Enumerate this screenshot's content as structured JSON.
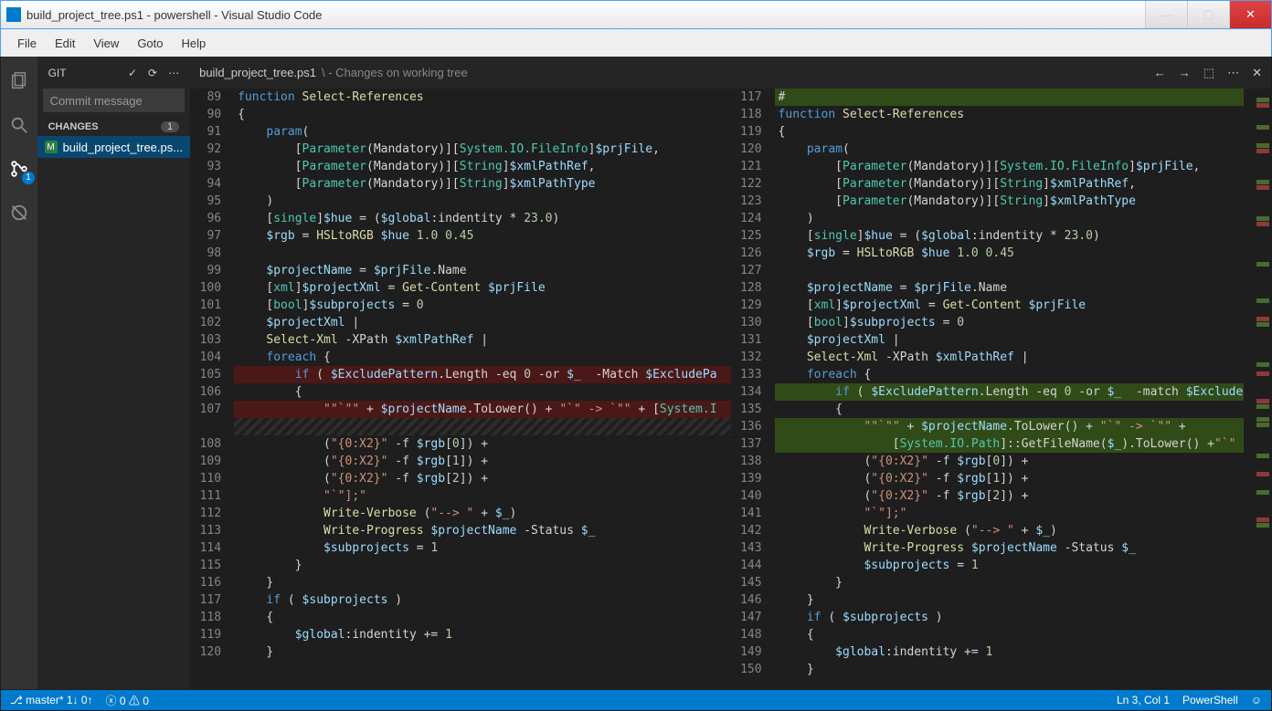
{
  "window": {
    "title": "build_project_tree.ps1 - powershell - Visual Studio Code"
  },
  "menu": {
    "file": "File",
    "edit": "Edit",
    "view": "View",
    "goto": "Goto",
    "help": "Help"
  },
  "activitybar": {
    "scm_badge": "1"
  },
  "sidebar": {
    "title": "GIT",
    "commit_placeholder": "Commit message",
    "section_label": "CHANGES",
    "changes_count": "1",
    "file_label": "build_project_tree.ps...",
    "file_status": "M"
  },
  "tab": {
    "name": "build_project_tree.ps1",
    "suffix": "\\ - Changes on working tree"
  },
  "left_lines": [
    {
      "n": "89",
      "cls": "",
      "html": "<span class='k-blue'>function</span> <span class='k-yellow'>Select-References</span>"
    },
    {
      "n": "90",
      "cls": "",
      "html": "<span class='k-plain'>{</span>"
    },
    {
      "n": "91",
      "cls": "",
      "html": "    <span class='k-blue'>param</span><span class='k-plain'>(</span>"
    },
    {
      "n": "92",
      "cls": "",
      "html": "        <span class='k-plain'>[</span><span class='k-teal'>Parameter</span><span class='k-plain'>(Mandatory)][</span><span class='k-teal'>System.IO.FileInfo</span><span class='k-plain'>]</span><span class='k-var'>$prjFile</span><span class='k-plain'>,</span>"
    },
    {
      "n": "93",
      "cls": "",
      "html": "        <span class='k-plain'>[</span><span class='k-teal'>Parameter</span><span class='k-plain'>(Mandatory)][</span><span class='k-teal'>String</span><span class='k-plain'>]</span><span class='k-var'>$xmlPathRef</span><span class='k-plain'>,</span>"
    },
    {
      "n": "94",
      "cls": "",
      "html": "        <span class='k-plain'>[</span><span class='k-teal'>Parameter</span><span class='k-plain'>(Mandatory)][</span><span class='k-teal'>String</span><span class='k-plain'>]</span><span class='k-var'>$xmlPathType</span>"
    },
    {
      "n": "95",
      "cls": "",
      "html": "    <span class='k-plain'>)</span>"
    },
    {
      "n": "96",
      "cls": "",
      "html": "    <span class='k-plain'>[</span><span class='k-teal'>single</span><span class='k-plain'>]</span><span class='k-var'>$hue</span> <span class='k-plain'>= (</span><span class='k-var'>$global</span><span class='k-plain'>:indentity * </span><span class='k-num'>23.0</span><span class='k-plain'>)</span>"
    },
    {
      "n": "97",
      "cls": "",
      "html": "    <span class='k-var'>$rgb</span> <span class='k-plain'>= </span><span class='k-yellow'>HSLtoRGB</span> <span class='k-var'>$hue</span> <span class='k-num'>1.0 0.45</span>"
    },
    {
      "n": "98",
      "cls": "",
      "html": ""
    },
    {
      "n": "99",
      "cls": "",
      "html": "    <span class='k-var'>$projectName</span> <span class='k-plain'>= </span><span class='k-var'>$prjFile</span><span class='k-plain'>.Name</span>"
    },
    {
      "n": "100",
      "cls": "",
      "html": "    <span class='k-plain'>[</span><span class='k-teal'>xml</span><span class='k-plain'>]</span><span class='k-var'>$projectXml</span> <span class='k-plain'>= </span><span class='k-yellow'>Get-Content</span> <span class='k-var'>$prjFile</span>"
    },
    {
      "n": "101",
      "cls": "",
      "html": "    <span class='k-plain'>[</span><span class='k-teal'>bool</span><span class='k-plain'>]</span><span class='k-var'>$subprojects</span> <span class='k-plain'>= </span><span class='k-num'>0</span>"
    },
    {
      "n": "102",
      "cls": "",
      "html": "    <span class='k-var'>$projectXml</span> <span class='k-plain'>|</span>"
    },
    {
      "n": "103",
      "cls": "",
      "html": "    <span class='k-yellow'>Select-Xml</span> <span class='k-plain'>-XPath </span><span class='k-var'>$xmlPathRef</span> <span class='k-plain'>|</span>"
    },
    {
      "n": "104",
      "cls": "",
      "html": "    <span class='k-blue'>foreach</span> <span class='k-plain'>{</span>"
    },
    {
      "n": "105",
      "cls": "del",
      "html": "        <span class='k-blue'>if</span> <span class='k-plain'>( </span><span class='k-var'>$ExcludePattern</span><span class='k-plain'>.Length -eq </span><span class='k-num'>0</span> <span class='k-plain'>-or </span><span class='k-var'>$_</span> <span class='k-plain'> -Match </span><span class='k-var'>$ExcludePa</span>"
    },
    {
      "n": "106",
      "cls": "",
      "html": "        <span class='k-plain'>{</span>"
    },
    {
      "n": "107",
      "cls": "del",
      "html": "            <span class='k-str'>\"\"`\"\"</span> <span class='k-plain'>+ </span><span class='k-var'>$projectName</span><span class='k-plain'>.ToLower() + </span><span class='k-str'>\"`\" -> `\"\"</span> <span class='k-plain'>+ [</span><span class='k-teal'>System.I</span>"
    },
    {
      "n": "",
      "cls": "hatch",
      "html": ""
    },
    {
      "n": "108",
      "cls": "",
      "html": "            <span class='k-plain'>(</span><span class='k-str'>\"{0:X2}\"</span> <span class='k-plain'>-f </span><span class='k-var'>$rgb</span><span class='k-plain'>[</span><span class='k-num'>0</span><span class='k-plain'>]) +</span>"
    },
    {
      "n": "109",
      "cls": "",
      "html": "            <span class='k-plain'>(</span><span class='k-str'>\"{0:X2}\"</span> <span class='k-plain'>-f </span><span class='k-var'>$rgb</span><span class='k-plain'>[</span><span class='k-num'>1</span><span class='k-plain'>]) +</span>"
    },
    {
      "n": "110",
      "cls": "",
      "html": "            <span class='k-plain'>(</span><span class='k-str'>\"{0:X2}\"</span> <span class='k-plain'>-f </span><span class='k-var'>$rgb</span><span class='k-plain'>[</span><span class='k-num'>2</span><span class='k-plain'>]) +</span>"
    },
    {
      "n": "111",
      "cls": "",
      "html": "            <span class='k-str'>\"`\"];\"</span>"
    },
    {
      "n": "112",
      "cls": "",
      "html": "            <span class='k-yellow'>Write-Verbose</span> <span class='k-plain'>(</span><span class='k-str'>\"--> \"</span> <span class='k-plain'>+ </span><span class='k-var'>$_</span><span class='k-plain'>)</span>"
    },
    {
      "n": "113",
      "cls": "",
      "html": "            <span class='k-yellow'>Write-Progress</span> <span class='k-var'>$projectName</span> <span class='k-plain'>-Status </span><span class='k-var'>$_</span>"
    },
    {
      "n": "114",
      "cls": "",
      "html": "            <span class='k-var'>$subprojects</span> <span class='k-plain'>= </span><span class='k-num'>1</span>"
    },
    {
      "n": "115",
      "cls": "",
      "html": "        <span class='k-plain'>}</span>"
    },
    {
      "n": "116",
      "cls": "",
      "html": "    <span class='k-plain'>}</span>"
    },
    {
      "n": "117",
      "cls": "",
      "html": "    <span class='k-blue'>if</span> <span class='k-plain'>( </span><span class='k-var'>$subprojects</span> <span class='k-plain'>)</span>"
    },
    {
      "n": "118",
      "cls": "",
      "html": "    <span class='k-plain'>{</span>"
    },
    {
      "n": "119",
      "cls": "",
      "html": "        <span class='k-var'>$global</span><span class='k-plain'>:indentity += </span><span class='k-num'>1</span>"
    },
    {
      "n": "120",
      "cls": "",
      "html": "    <span class='k-plain'>}</span>"
    }
  ],
  "right_lines": [
    {
      "n": "117",
      "cls": "add",
      "html": "<span class='k-plain'>#</span>"
    },
    {
      "n": "118",
      "cls": "",
      "html": "<span class='k-blue'>function</span> <span class='k-yellow'>Select-References</span>"
    },
    {
      "n": "119",
      "cls": "",
      "html": "<span class='k-plain'>{</span>"
    },
    {
      "n": "120",
      "cls": "",
      "html": "    <span class='k-blue'>param</span><span class='k-plain'>(</span>"
    },
    {
      "n": "121",
      "cls": "",
      "html": "        <span class='k-plain'>[</span><span class='k-teal'>Parameter</span><span class='k-plain'>(Mandatory)][</span><span class='k-teal'>System.IO.FileInfo</span><span class='k-plain'>]</span><span class='k-var'>$prjFile</span><span class='k-plain'>,</span>"
    },
    {
      "n": "122",
      "cls": "",
      "html": "        <span class='k-plain'>[</span><span class='k-teal'>Parameter</span><span class='k-plain'>(Mandatory)][</span><span class='k-teal'>String</span><span class='k-plain'>]</span><span class='k-var'>$xmlPathRef</span><span class='k-plain'>,</span>"
    },
    {
      "n": "123",
      "cls": "",
      "html": "        <span class='k-plain'>[</span><span class='k-teal'>Parameter</span><span class='k-plain'>(Mandatory)][</span><span class='k-teal'>String</span><span class='k-plain'>]</span><span class='k-var'>$xmlPathType</span>"
    },
    {
      "n": "124",
      "cls": "",
      "html": "    <span class='k-plain'>)</span>"
    },
    {
      "n": "125",
      "cls": "",
      "html": "    <span class='k-plain'>[</span><span class='k-teal'>single</span><span class='k-plain'>]</span><span class='k-var'>$hue</span> <span class='k-plain'>= (</span><span class='k-var'>$global</span><span class='k-plain'>:indentity * </span><span class='k-num'>23.0</span><span class='k-plain'>)</span>"
    },
    {
      "n": "126",
      "cls": "",
      "html": "    <span class='k-var'>$rgb</span> <span class='k-plain'>= </span><span class='k-yellow'>HSLtoRGB</span> <span class='k-var'>$hue</span> <span class='k-num'>1.0 0.45</span>"
    },
    {
      "n": "127",
      "cls": "",
      "html": ""
    },
    {
      "n": "128",
      "cls": "",
      "html": "    <span class='k-var'>$projectName</span> <span class='k-plain'>= </span><span class='k-var'>$prjFile</span><span class='k-plain'>.Name</span>"
    },
    {
      "n": "129",
      "cls": "",
      "html": "    <span class='k-plain'>[</span><span class='k-teal'>xml</span><span class='k-plain'>]</span><span class='k-var'>$projectXml</span> <span class='k-plain'>= </span><span class='k-yellow'>Get-Content</span> <span class='k-var'>$prjFile</span>"
    },
    {
      "n": "130",
      "cls": "",
      "html": "    <span class='k-plain'>[</span><span class='k-teal'>bool</span><span class='k-plain'>]</span><span class='k-var'>$subprojects</span> <span class='k-plain'>= </span><span class='k-num'>0</span>"
    },
    {
      "n": "131",
      "cls": "",
      "html": "    <span class='k-var'>$projectXml</span> <span class='k-plain'>|</span>"
    },
    {
      "n": "132",
      "cls": "",
      "html": "    <span class='k-yellow'>Select-Xml</span> <span class='k-plain'>-XPath </span><span class='k-var'>$xmlPathRef</span> <span class='k-plain'>|</span>"
    },
    {
      "n": "133",
      "cls": "",
      "html": "    <span class='k-blue'>foreach</span> <span class='k-plain'>{</span>"
    },
    {
      "n": "134",
      "cls": "add",
      "html": "        <span class='k-blue'>if</span> <span class='k-plain'>( </span><span class='k-var'>$ExcludePattern</span><span class='k-plain'>.Length -eq </span><span class='k-num'>0</span> <span class='k-plain'>-or </span><span class='k-var'>$_</span> <span class='k-plain'> -match </span><span class='k-var'>$ExcludePa</span>"
    },
    {
      "n": "135",
      "cls": "",
      "html": "        <span class='k-plain'>{</span>"
    },
    {
      "n": "136",
      "cls": "add",
      "html": "            <span class='k-str'>\"\"`\"\"</span> <span class='k-plain'>+ </span><span class='k-var'>$projectName</span><span class='k-plain'>.ToLower() + </span><span class='k-str'>\"`\" -> `\"\"</span> <span class='k-plain'>+</span>"
    },
    {
      "n": "137",
      "cls": "add",
      "html": "                <span class='k-plain'>[</span><span class='k-teal'>System.IO.Path</span><span class='k-plain'>]::GetFileName(</span><span class='k-var'>$_</span><span class='k-plain'>).ToLower() +</span><span class='k-str'>\"`\"</span> <span class='k-plain'>[</span>"
    },
    {
      "n": "138",
      "cls": "",
      "html": "            <span class='k-plain'>(</span><span class='k-str'>\"{0:X2}\"</span> <span class='k-plain'>-f </span><span class='k-var'>$rgb</span><span class='k-plain'>[</span><span class='k-num'>0</span><span class='k-plain'>]) +</span>"
    },
    {
      "n": "139",
      "cls": "",
      "html": "            <span class='k-plain'>(</span><span class='k-str'>\"{0:X2}\"</span> <span class='k-plain'>-f </span><span class='k-var'>$rgb</span><span class='k-plain'>[</span><span class='k-num'>1</span><span class='k-plain'>]) +</span>"
    },
    {
      "n": "140",
      "cls": "",
      "html": "            <span class='k-plain'>(</span><span class='k-str'>\"{0:X2}\"</span> <span class='k-plain'>-f </span><span class='k-var'>$rgb</span><span class='k-plain'>[</span><span class='k-num'>2</span><span class='k-plain'>]) +</span>"
    },
    {
      "n": "141",
      "cls": "",
      "html": "            <span class='k-str'>\"`\"];\"</span>"
    },
    {
      "n": "142",
      "cls": "",
      "html": "            <span class='k-yellow'>Write-Verbose</span> <span class='k-plain'>(</span><span class='k-str'>\"--> \"</span> <span class='k-plain'>+ </span><span class='k-var'>$_</span><span class='k-plain'>)</span>"
    },
    {
      "n": "143",
      "cls": "",
      "html": "            <span class='k-yellow'>Write-Progress</span> <span class='k-var'>$projectName</span> <span class='k-plain'>-Status </span><span class='k-var'>$_</span>"
    },
    {
      "n": "144",
      "cls": "",
      "html": "            <span class='k-var'>$subprojects</span> <span class='k-plain'>= </span><span class='k-num'>1</span>"
    },
    {
      "n": "145",
      "cls": "",
      "html": "        <span class='k-plain'>}</span>"
    },
    {
      "n": "146",
      "cls": "",
      "html": "    <span class='k-plain'>}</span>"
    },
    {
      "n": "147",
      "cls": "",
      "html": "    <span class='k-blue'>if</span> <span class='k-plain'>( </span><span class='k-var'>$subprojects</span> <span class='k-plain'>)</span>"
    },
    {
      "n": "148",
      "cls": "",
      "html": "    <span class='k-plain'>{</span>"
    },
    {
      "n": "149",
      "cls": "",
      "html": "        <span class='k-var'>$global</span><span class='k-plain'>:indentity += </span><span class='k-num'>1</span>"
    },
    {
      "n": "150",
      "cls": "",
      "html": "    <span class='k-plain'>}</span>"
    }
  ],
  "status": {
    "branch": "master*",
    "sync": "1↓ 0↑",
    "errors": "0",
    "warnings": "0",
    "position": "Ln 3, Col 1",
    "language": "PowerShell"
  }
}
